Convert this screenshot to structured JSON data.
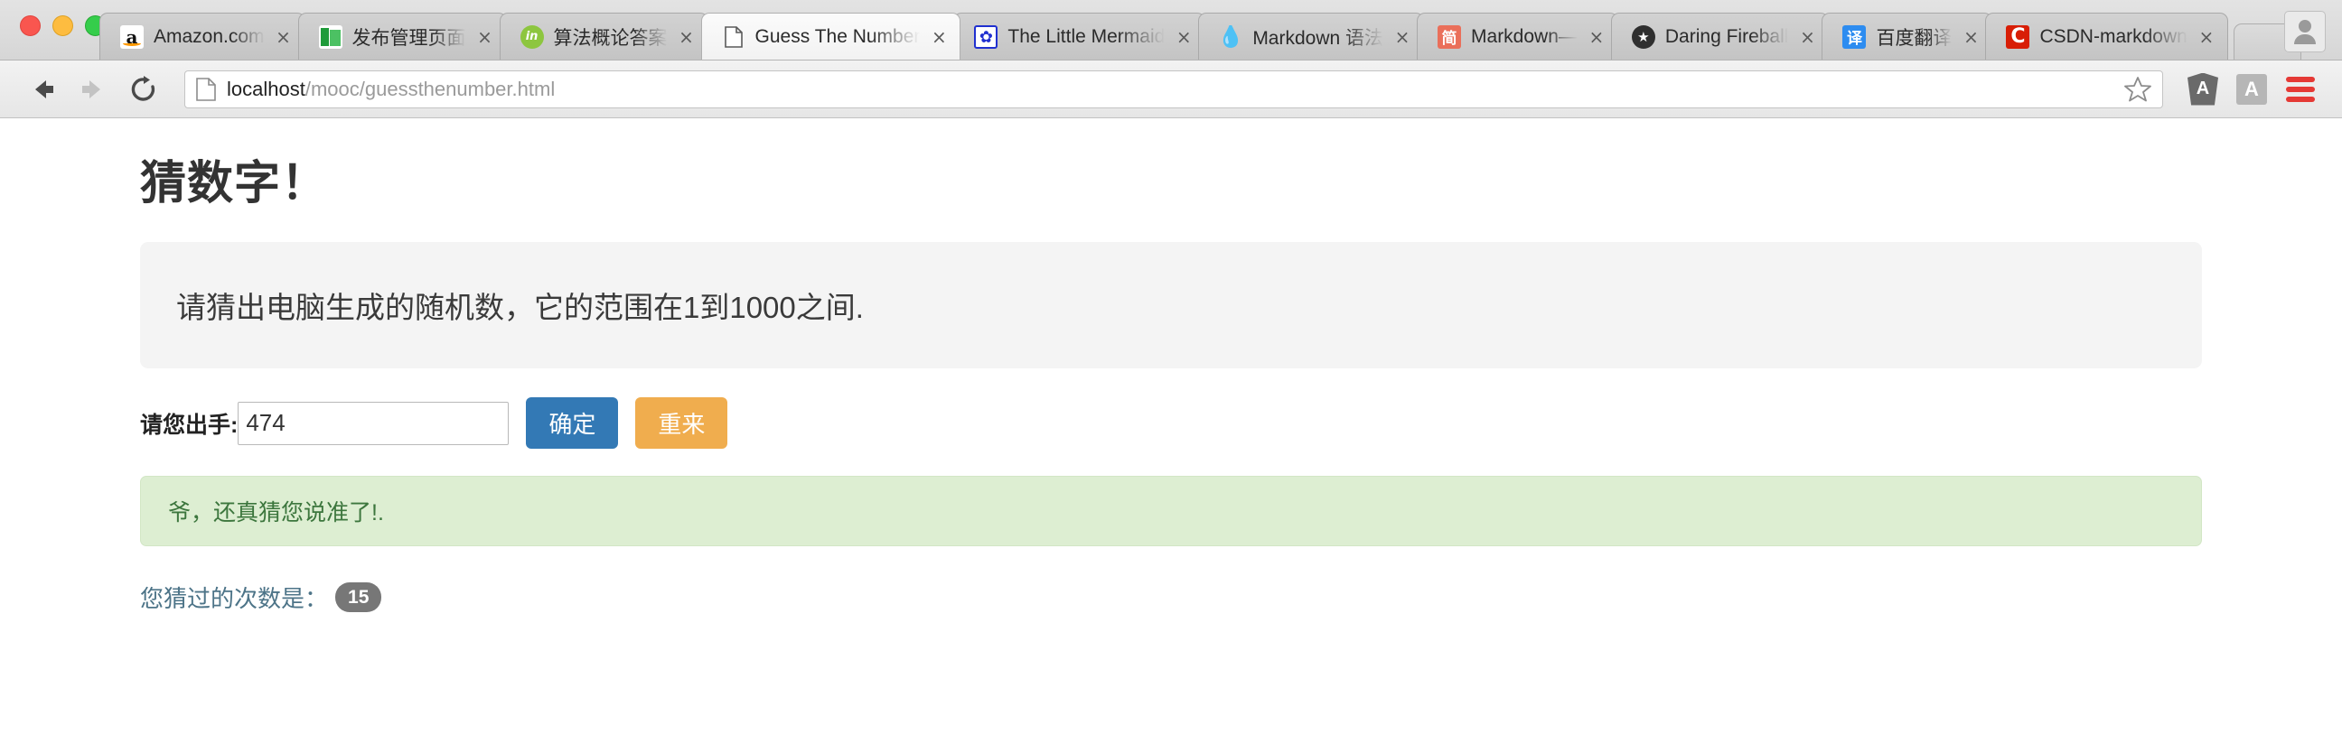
{
  "window": {
    "traffic_lights": [
      "close",
      "minimize",
      "zoom"
    ],
    "new_tab_label": "",
    "profile_label": ""
  },
  "tabs": [
    {
      "title": "Amazon.com",
      "favicon": "amazon-icon",
      "active": false,
      "close_label": "×"
    },
    {
      "title": "发布管理页面",
      "favicon": "book-icon",
      "active": false,
      "close_label": "×"
    },
    {
      "title": "算法概论答案",
      "favicon": "linkedin-icon",
      "active": false,
      "close_label": "×"
    },
    {
      "title": "Guess The Number",
      "favicon": "document-icon",
      "active": true,
      "close_label": "×"
    },
    {
      "title": "The Little Mermaid",
      "favicon": "paw-icon",
      "active": false,
      "close_label": "×"
    },
    {
      "title": "Markdown 语法",
      "favicon": "water-drop-icon",
      "active": false,
      "close_label": "×"
    },
    {
      "title": "Markdown—",
      "favicon": "jianshu-icon",
      "active": false,
      "close_label": "×"
    },
    {
      "title": "Daring Fireball",
      "favicon": "star-icon",
      "active": false,
      "close_label": "×"
    },
    {
      "title": "百度翻译",
      "favicon": "translate-icon",
      "active": false,
      "close_label": "×"
    },
    {
      "title": "CSDN-markdown",
      "favicon": "csdn-icon",
      "active": false,
      "close_label": "×"
    }
  ],
  "toolbar": {
    "back_icon": "back-arrow-icon",
    "forward_icon": "forward-arrow-icon",
    "reload_icon": "reload-icon",
    "page_icon": "page-document-icon",
    "url_host": "localhost",
    "url_path": "/mooc/guessthenumber.html",
    "bookmark_icon": "star-outline-icon",
    "extension_angular": "A",
    "extension_a": "A",
    "menu_icon": "hamburger-menu-icon"
  },
  "content": {
    "title": "猜数字！",
    "jumbotron_text": "请猜出电脑生成的随机数，它的范围在1到1000之间.",
    "form": {
      "label": "请您出手:",
      "input_value": "474",
      "input_placeholder": "",
      "submit_label": "确定",
      "reset_label": "重来"
    },
    "alert": {
      "message": "爷，还真猜您说准了!.",
      "type": "success",
      "color": "#3c763d",
      "background": "#ddeed2"
    },
    "counter": {
      "label": "您猜过的次数是：",
      "value": "15"
    }
  },
  "colors": {
    "primary_button": "#3379b5",
    "warning_button": "#f0ad4e",
    "badge": "#777777",
    "jumbotron": "#f4f4f4",
    "menu_accent": "#e53935"
  }
}
